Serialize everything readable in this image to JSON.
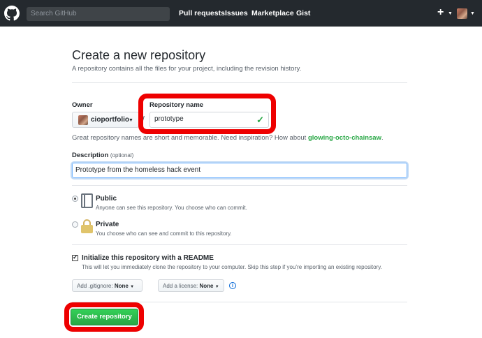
{
  "header": {
    "search_placeholder": "Search GitHub",
    "nav": [
      "Pull requests",
      "Issues",
      "Marketplace",
      "Gist"
    ],
    "plus": "+"
  },
  "page": {
    "title": "Create a new repository",
    "subtitle": "A repository contains all the files for your project, including the revision history."
  },
  "form": {
    "owner_label": "Owner",
    "owner_value": "cioportfolio",
    "slash": "/",
    "repo_label": "Repository name",
    "repo_value": "prototype",
    "hint_prefix": "Great repository names are short and memorable. Need inspiration? How about ",
    "hint_suggestion": "glowing-octo-chainsaw",
    "hint_suffix": ".",
    "description_label": "Description",
    "description_optional": "(optional)",
    "description_value": "Prototype from the homeless hack event",
    "visibility": [
      {
        "title": "Public",
        "desc": "Anyone can see this repository. You choose who can commit.",
        "selected": true
      },
      {
        "title": "Private",
        "desc": "You choose who can see and commit to this repository.",
        "selected": false
      }
    ],
    "init_readme_title": "Initialize this repository with a README",
    "init_readme_desc": "This will let you immediately clone the repository to your computer. Skip this step if you’re importing an existing repository.",
    "init_readme_checked": true,
    "gitignore_label": "Add .gitignore:",
    "gitignore_value": "None",
    "license_label": "Add a license:",
    "license_value": "None",
    "create_button": "Create repository"
  },
  "colors": {
    "header_bg": "#24292e",
    "accent_green": "#28a745",
    "highlight_red": "#ee0000",
    "focus_blue": "#79b8ff"
  },
  "icons": [
    "github-logo-icon",
    "plus-icon",
    "chevron-down-icon",
    "check-icon",
    "repo-icon",
    "lock-icon",
    "info-icon"
  ]
}
